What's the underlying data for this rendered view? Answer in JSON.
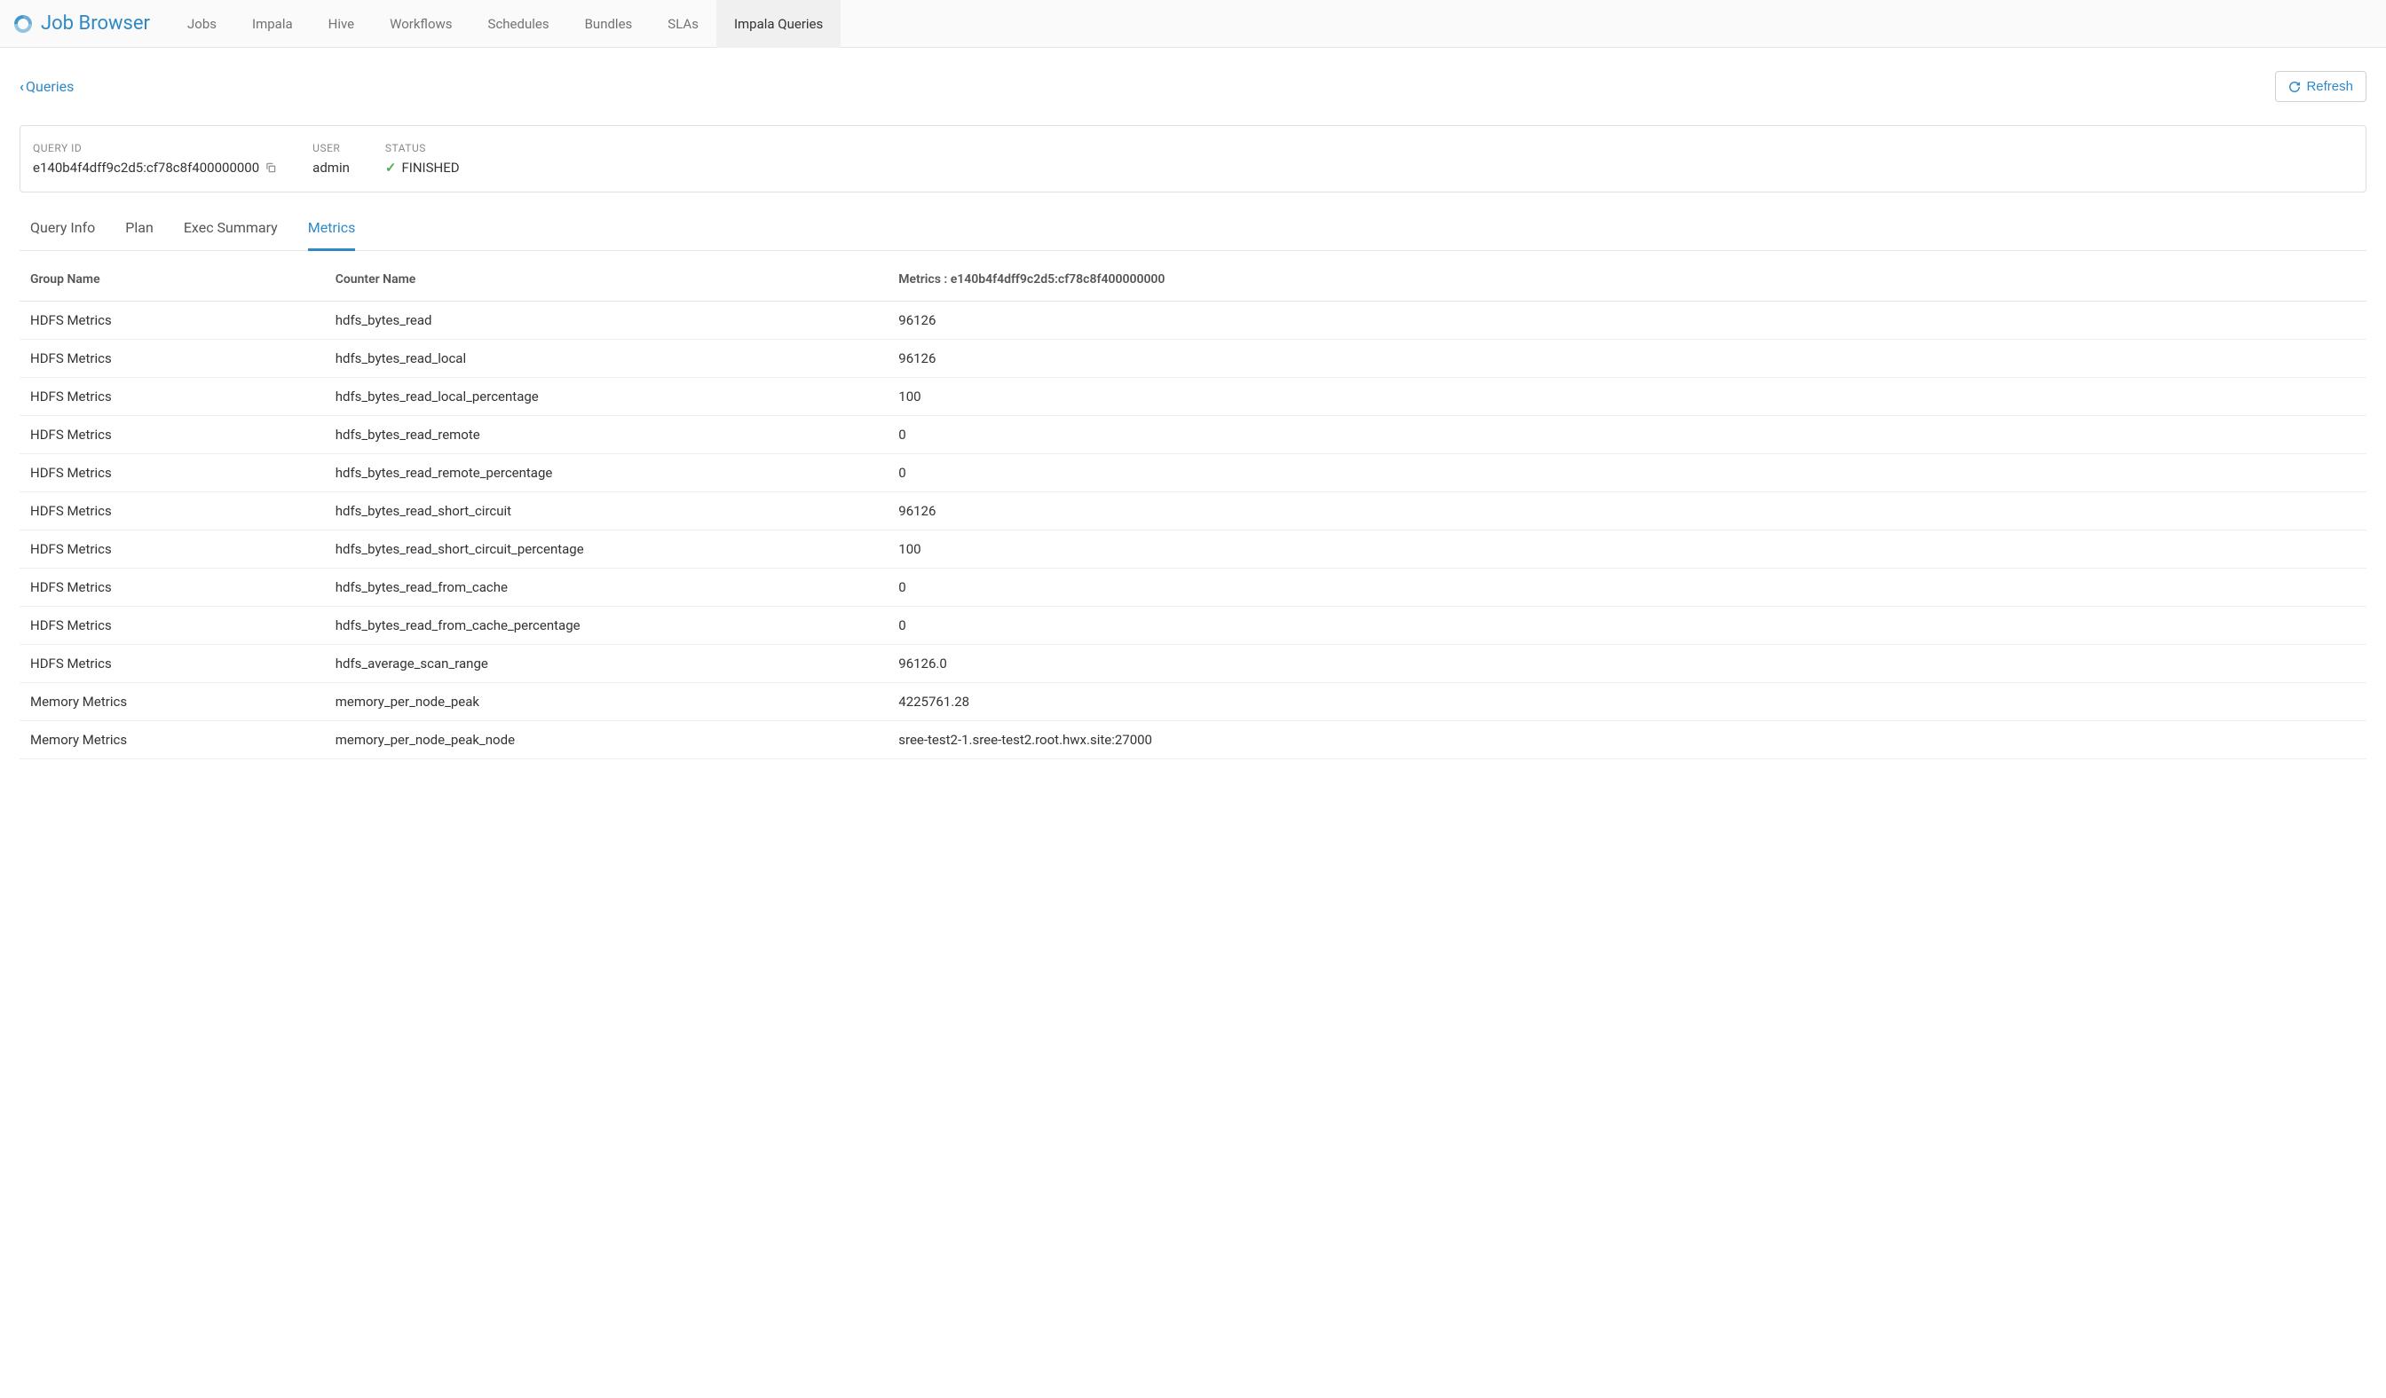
{
  "brand": "Job Browser",
  "nav": [
    {
      "label": "Jobs",
      "active": false
    },
    {
      "label": "Impala",
      "active": false
    },
    {
      "label": "Hive",
      "active": false
    },
    {
      "label": "Workflows",
      "active": false
    },
    {
      "label": "Schedules",
      "active": false
    },
    {
      "label": "Bundles",
      "active": false
    },
    {
      "label": "SLAs",
      "active": false
    },
    {
      "label": "Impala Queries",
      "active": true
    }
  ],
  "back_link": "Queries",
  "refresh_label": "Refresh",
  "info": {
    "query_id_label": "QUERY ID",
    "query_id": "e140b4f4dff9c2d5:cf78c8f400000000",
    "user_label": "USER",
    "user": "admin",
    "status_label": "STATUS",
    "status": "FINISHED"
  },
  "subtabs": [
    {
      "label": "Query Info",
      "active": false
    },
    {
      "label": "Plan",
      "active": false
    },
    {
      "label": "Exec Summary",
      "active": false
    },
    {
      "label": "Metrics",
      "active": true
    }
  ],
  "table": {
    "headers": {
      "group": "Group Name",
      "counter": "Counter Name",
      "metric": "Metrics : e140b4f4dff9c2d5:cf78c8f400000000"
    },
    "rows": [
      {
        "group": "HDFS Metrics",
        "counter": "hdfs_bytes_read",
        "value": "96126"
      },
      {
        "group": "HDFS Metrics",
        "counter": "hdfs_bytes_read_local",
        "value": "96126"
      },
      {
        "group": "HDFS Metrics",
        "counter": "hdfs_bytes_read_local_percentage",
        "value": "100"
      },
      {
        "group": "HDFS Metrics",
        "counter": "hdfs_bytes_read_remote",
        "value": "0"
      },
      {
        "group": "HDFS Metrics",
        "counter": "hdfs_bytes_read_remote_percentage",
        "value": "0"
      },
      {
        "group": "HDFS Metrics",
        "counter": "hdfs_bytes_read_short_circuit",
        "value": "96126"
      },
      {
        "group": "HDFS Metrics",
        "counter": "hdfs_bytes_read_short_circuit_percentage",
        "value": "100"
      },
      {
        "group": "HDFS Metrics",
        "counter": "hdfs_bytes_read_from_cache",
        "value": "0"
      },
      {
        "group": "HDFS Metrics",
        "counter": "hdfs_bytes_read_from_cache_percentage",
        "value": "0"
      },
      {
        "group": "HDFS Metrics",
        "counter": "hdfs_average_scan_range",
        "value": "96126.0"
      },
      {
        "group": "Memory Metrics",
        "counter": "memory_per_node_peak",
        "value": "4225761.28"
      },
      {
        "group": "Memory Metrics",
        "counter": "memory_per_node_peak_node",
        "value": "sree-test2-1.sree-test2.root.hwx.site:27000"
      }
    ]
  }
}
